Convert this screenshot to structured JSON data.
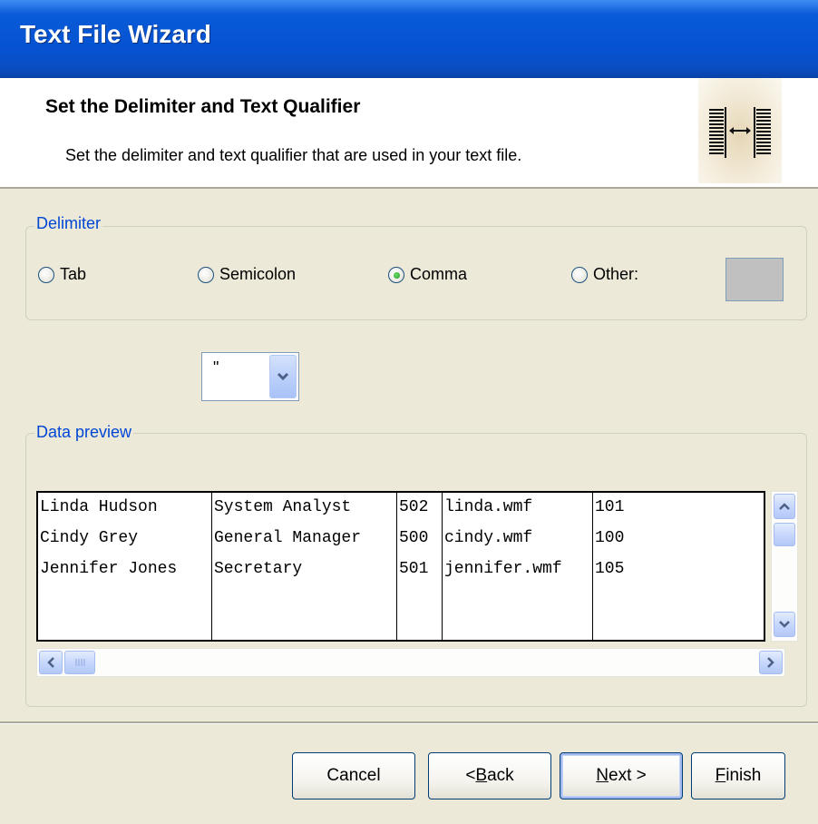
{
  "window": {
    "title": "Text File Wizard"
  },
  "header": {
    "title": "Set the Delimiter and Text Qualifier",
    "subtitle": "Set the delimiter and text qualifier that are used in your text file.",
    "icon": "column-split-icon"
  },
  "delimiter": {
    "legend": "Delimiter",
    "options": [
      {
        "label": "Tab",
        "mnemonic": "T",
        "rest": "ab",
        "checked": false
      },
      {
        "label": "Semicolon",
        "mnemonic": "S",
        "rest": "emicolon",
        "checked": false
      },
      {
        "label": "Comma",
        "mnemonic": "C",
        "rest": "omma",
        "checked": true
      },
      {
        "label": "Other:",
        "mnemonic": "O",
        "rest": "ther:",
        "checked": false
      }
    ],
    "other_value": ""
  },
  "qualifier": {
    "value": "\""
  },
  "preview": {
    "legend": "Data preview",
    "rows": [
      [
        "Linda Hudson",
        "System Analyst",
        "502",
        "linda.wmf",
        "101"
      ],
      [
        "Cindy Grey",
        "General Manager",
        "500",
        "cindy.wmf",
        "100"
      ],
      [
        "Jennifer Jones",
        "Secretary",
        "501",
        "jennifer.wmf",
        "105"
      ]
    ]
  },
  "buttons": {
    "cancel": "Cancel",
    "back": {
      "prefix": "< ",
      "mnemonic": "B",
      "rest": "ack"
    },
    "next": {
      "mnemonic": "N",
      "rest": "ext >"
    },
    "finish": {
      "mnemonic": "F",
      "rest": "inish"
    }
  },
  "colors": {
    "titlebar": "#0553d2",
    "legend": "#0046d5",
    "face": "#ece9d8",
    "radio_dot": "#219a20"
  }
}
